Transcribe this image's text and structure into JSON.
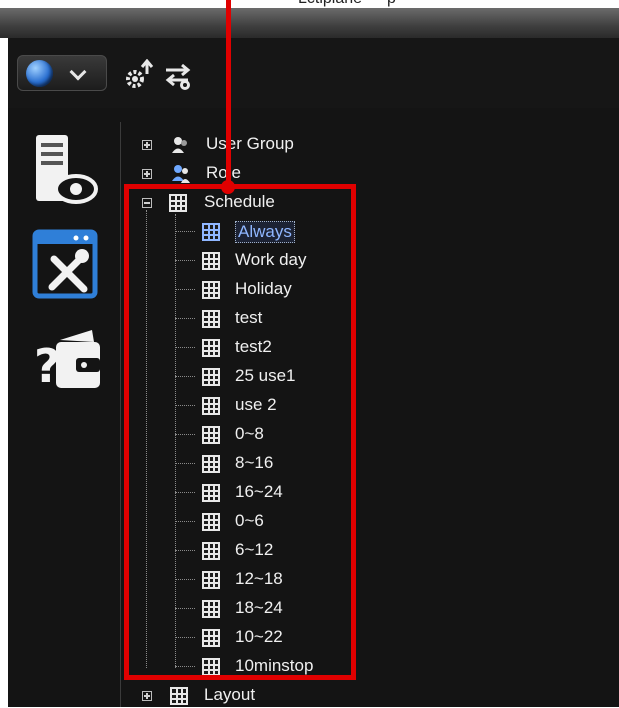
{
  "top_caption": "Lctiplane — p",
  "toolbar": {
    "globe_icon": "globe-icon",
    "dropdown_icon": "chevron-down-icon",
    "tool_icons": [
      "gear-upload-icon",
      "sync-settings-icon"
    ]
  },
  "sidebar": {
    "icons": [
      "server-monitor-icon",
      "settings-tools-icon",
      "help-wallet-icon"
    ]
  },
  "tree": {
    "user_group": "User Group",
    "role": "Role",
    "schedule": "Schedule",
    "schedule_items": [
      "Always",
      "Work day",
      "Holiday",
      "test",
      "test2",
      "25 use1",
      "use 2",
      "0~8",
      "8~16",
      "16~24",
      "0~6",
      "6~12",
      "12~18",
      "18~24",
      "10~22",
      "10minstop"
    ],
    "selected": "Always",
    "layout": "Layout"
  },
  "colors": {
    "callout": "#e00000",
    "selection": "#8fb6ff",
    "background": "#141414"
  }
}
